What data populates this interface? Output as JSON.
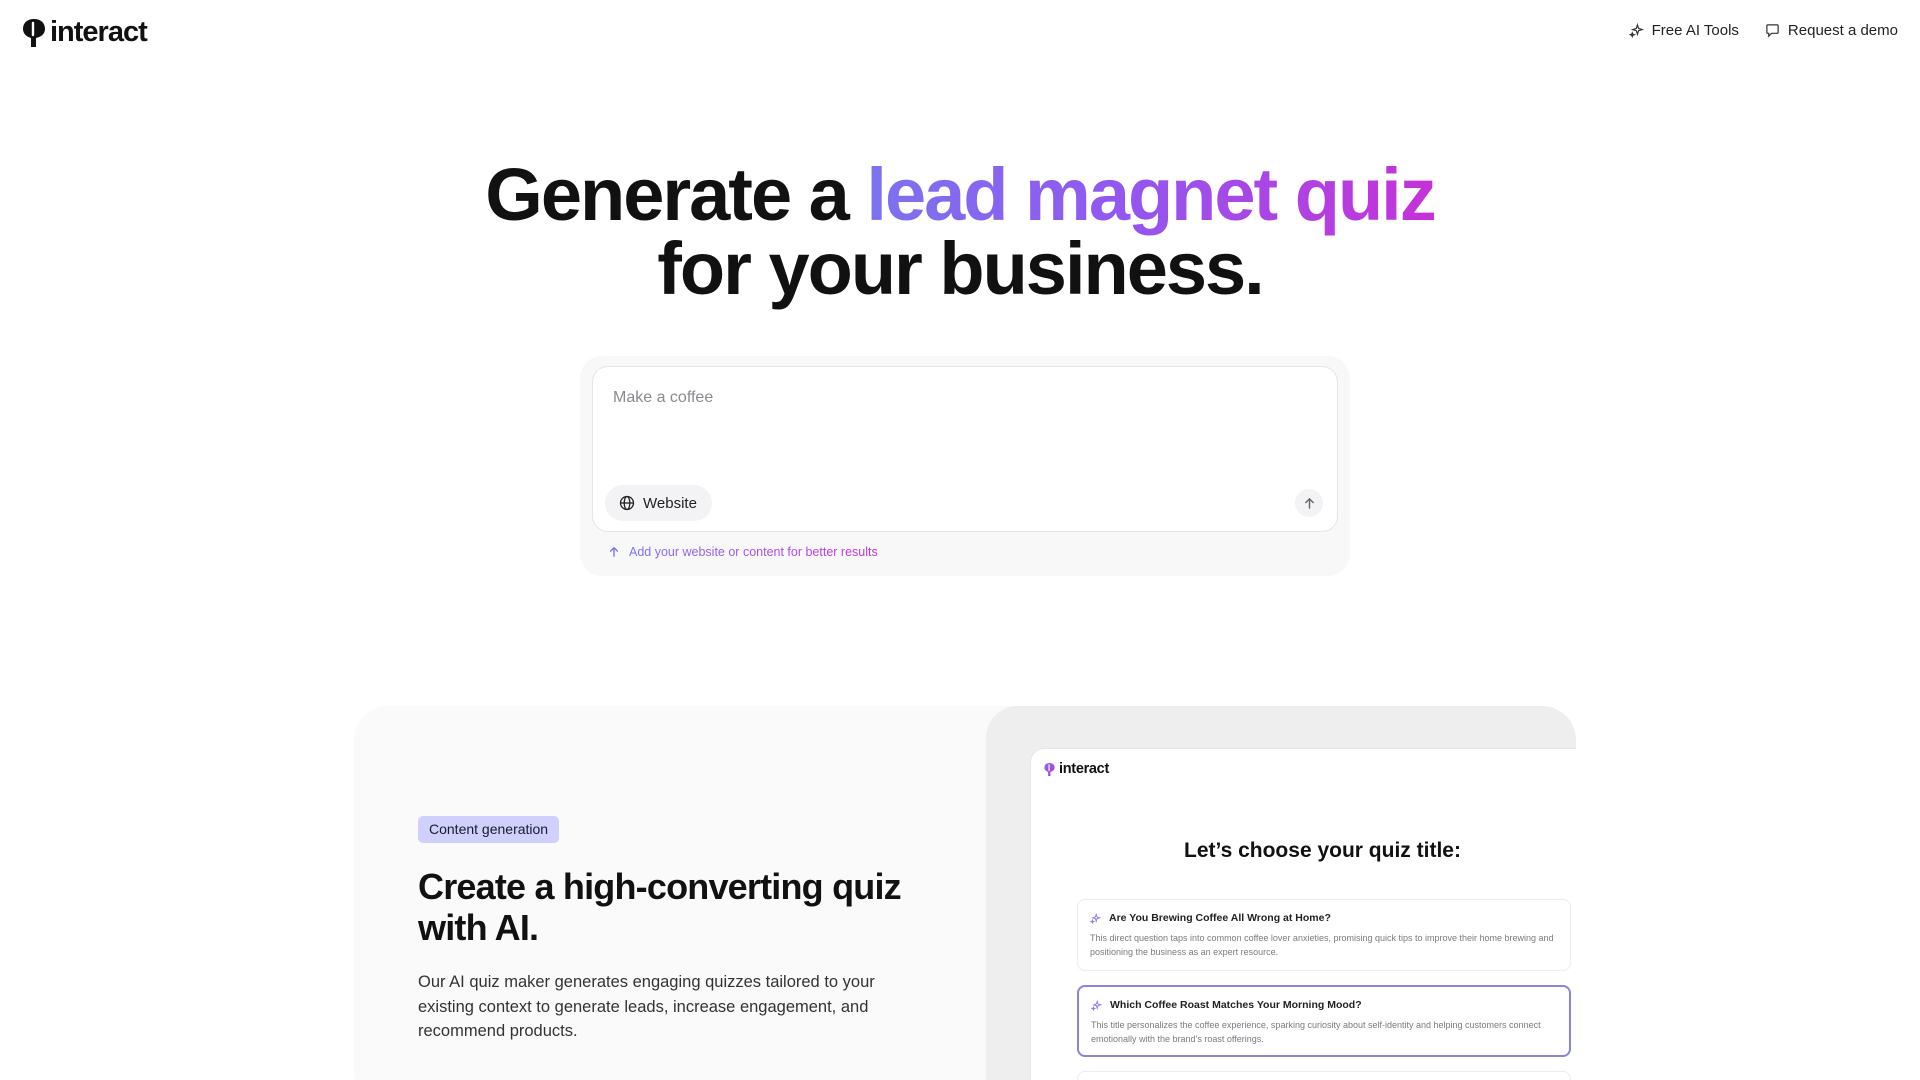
{
  "header": {
    "logo_text": "interact",
    "nav": [
      {
        "label": "Free AI Tools",
        "icon": "sparkle-icon"
      },
      {
        "label": "Request a demo",
        "icon": "chat-bubble-icon"
      }
    ]
  },
  "hero": {
    "line1_prefix": "Generate a ",
    "line1_highlight": "lead magnet quiz",
    "line2": "for your business."
  },
  "prompt": {
    "placeholder": "Make a coffee",
    "value": "",
    "website_button": "Website",
    "hint": "Add your website or content for better results"
  },
  "feature": {
    "badge": "Content generation",
    "title": "Create a high-converting quiz with AI.",
    "description": "Our AI quiz maker generates engaging quizzes tailored to your existing context to generate leads, increase engagement, and recommend products."
  },
  "mockup": {
    "logo_text": "interact",
    "title": "Let’s choose your quiz title:",
    "options": [
      {
        "title": "Are You Brewing Coffee All Wrong at Home?",
        "description": "This direct question taps into common coffee lover anxieties, promising quick tips to improve their home brewing and positioning the business as an expert resource.",
        "selected": false
      },
      {
        "title": "Which Coffee Roast Matches Your Morning Mood?",
        "description": "This title personalizes the coffee experience, sparking curiosity about self-identity and helping customers connect emotionally with the brand’s roast offerings.",
        "selected": true
      }
    ]
  },
  "colors": {
    "gradient_start": "#7c73ef",
    "gradient_end": "#c631d8",
    "badge_bg": "#cfd0fb",
    "selected_border": "#8a86d6"
  }
}
